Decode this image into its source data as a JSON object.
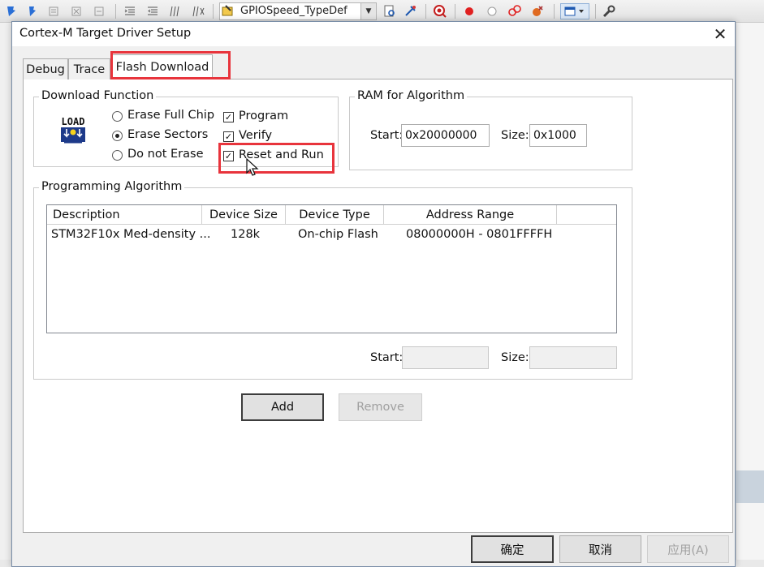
{
  "ide": {
    "toolbar_combo_value": "GPIOSpeed_TypeDef",
    "toolbar_icons": [
      "bookmark-icon",
      "bookmark-prev-icon",
      "bookmark-next-icon",
      "bookmark-clear-icon",
      "indent-icon",
      "unindent-icon",
      "comment-icon",
      "uncomment-icon",
      "find-in-files-icon",
      "incremental-find-icon",
      "debug-icon",
      "breakpoint-icon",
      "breakpoint-disable-icon",
      "breakpoint-clear-icon",
      "breakpoint-kill-icon",
      "window-layout-icon",
      "configure-icon"
    ]
  },
  "dialog": {
    "title": "Cortex-M Target Driver Setup",
    "close_glyph": "✕",
    "tabs": [
      {
        "label": "Debug"
      },
      {
        "label": "Trace"
      },
      {
        "label": "Flash Download",
        "active": true
      }
    ],
    "download_function": {
      "label": "Download Function",
      "icon_text": "LOAD",
      "radios": [
        {
          "label": "Erase Full Chip",
          "checked": false
        },
        {
          "label": "Erase Sectors",
          "checked": true
        },
        {
          "label": "Do not Erase",
          "checked": false
        }
      ],
      "checkboxes": [
        {
          "label": "Program",
          "checked": true
        },
        {
          "label": "Verify",
          "checked": true
        },
        {
          "label": "Reset and Run",
          "checked": true
        }
      ]
    },
    "ram_for_algorithm": {
      "label": "RAM for Algorithm",
      "start_label": "Start:",
      "start_value": "0x20000000",
      "size_label": "Size:",
      "size_value": "0x1000"
    },
    "programming_algorithm": {
      "label": "Programming Algorithm",
      "columns": [
        "Description",
        "Device Size",
        "Device Type",
        "Address Range"
      ],
      "rows": [
        [
          "STM32F10x Med-density ...",
          "128k",
          "On-chip Flash",
          "08000000H - 0801FFFFH"
        ]
      ],
      "start_label": "Start:",
      "start_value": "",
      "size_label": "Size:",
      "size_value": ""
    },
    "add_button": "Add",
    "remove_button": "Remove",
    "ok_button": "确定",
    "cancel_button": "取消",
    "apply_button": "应用(A)",
    "annotation_color": "#e8343c"
  }
}
